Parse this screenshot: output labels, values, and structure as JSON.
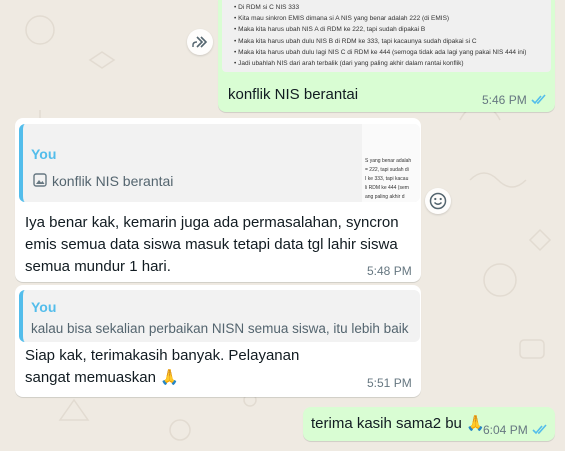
{
  "chat": {
    "msg1": {
      "doc_lines": [
        "Di RDM si C NIS 333",
        "Kita mau sinkron EMIS dimana si A NIS yang benar adalah 222 (di EMIS)",
        "Maka kita harus ubah NIS A di RDM ke 222, tapi sudah dipakai B",
        "Maka kita harus ubah dulu NIS B di RDM ke 333, tapi kacaunya sudah dipakai si C",
        "Maka kita harus ubah dulu lagi NIS C di RDM ke 444 (semoga tidak ada lagi yang pakai NIS 444 ini)",
        "Jadi ubahlah NIS dari arah terbalik (dari yang paling akhir dalam rantai konflik)"
      ],
      "caption": "konflik NIS berantai",
      "time": "5:46 PM"
    },
    "msg2": {
      "quote_author": "You",
      "quote_text": "konflik NIS berantai",
      "quote_thumb_lines": [
        "S yang benar adalah",
        "= 222, tapi sudah di",
        "I ke 333, tapi kacau",
        "li RDM ke 444 (sem",
        "ang paling akhir d"
      ],
      "text": "Iya benar kak, kemarin juga ada permasalahan, syncron emis semua data siswa masuk tetapi data tgl lahir siswa semua mundur 1 hari.",
      "time": "5:48 PM"
    },
    "msg3": {
      "quote_author": "You",
      "quote_text": "kalau bisa sekalian perbaikan NISN semua siswa, itu lebih baik",
      "text": "Siap kak, terimakasih banyak. Pelayanan sangat memuaskan 🙏",
      "time": "5:51 PM"
    },
    "msg4": {
      "text": "terima kasih sama2 bu 🙏",
      "time": "6:04 PM"
    }
  },
  "icons": {
    "forward": "forward-icon",
    "emoji": "emoji-smile-icon",
    "image": "image-icon",
    "read_ticks": "double-check-read-icon"
  },
  "colors": {
    "background": "#efeae2",
    "outgoing": "#d9fdd3",
    "incoming": "#ffffff",
    "quote_accent": "#53bdeb",
    "read_ticks": "#53bdeb",
    "timestamp": "#667781"
  }
}
